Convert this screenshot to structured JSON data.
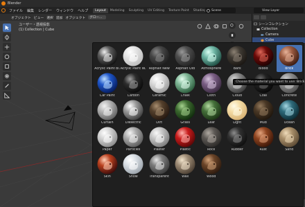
{
  "window": {
    "title": "Blender"
  },
  "menubar": {
    "menus": [
      "ファイル",
      "編集",
      "レンダー",
      "ウィンドウ",
      "ヘルプ"
    ],
    "workspaces": [
      "Layout",
      "Modeling",
      "Sculpting",
      "UV Editing",
      "Texture Paint",
      "Shading",
      "Ani"
    ],
    "active_workspace": "Layout",
    "scene_label": "Scene",
    "view_layer_label": "View Layer"
  },
  "viewport": {
    "header_items": [
      "オブジェクト",
      "ビュー",
      "選択",
      "追加",
      "オブジェクト"
    ],
    "orientation": "グロー...",
    "info_line1": "ユーザー・透視投影",
    "info_line2": "(1) Collection | Cube"
  },
  "outliner": {
    "rows": [
      {
        "label": "シーンコレクション",
        "icon": "scene-collection-icon"
      },
      {
        "label": "Collection",
        "icon": "collection-icon"
      },
      {
        "label": "Camera",
        "icon": "camera-icon"
      },
      {
        "label": "Cube",
        "icon": "cube-icon"
      }
    ]
  },
  "materials": [
    {
      "name": "Acrylic Paint Bl...",
      "base": "#101010",
      "mid": "#5a5a5a",
      "hi": "#f0f0f0"
    },
    {
      "name": "Acrylic Paint W...",
      "base": "#bdbdbd",
      "mid": "#e4e4e4",
      "hi": "#ffffff"
    },
    {
      "name": "Asphalt New",
      "base": "#1c1c1c",
      "mid": "#444444",
      "hi": "#8a8a8a"
    },
    {
      "name": "Asphalt Old",
      "base": "#262626",
      "mid": "#4d4d4d",
      "hi": "#9a9a9a"
    },
    {
      "name": "Atmosphere",
      "base": "#1e4d42",
      "mid": "#6db4a3",
      "hi": "#d9fff3"
    },
    {
      "name": "Bark",
      "base": "#1a1612",
      "mid": "#3f3a33",
      "hi": "#8d8274"
    },
    {
      "name": "Blood",
      "base": "#1c0202",
      "mid": "#6b0a08",
      "hi": "#e06a5a"
    },
    {
      "name": "Brick",
      "base": "#3a1a10",
      "mid": "#9a5a40",
      "hi": "#e8b49a"
    },
    {
      "name": "Car Paint",
      "base": "#041a5a",
      "mid": "#1f56c8",
      "hi": "#bfe0ff"
    },
    {
      "name": "Carbon",
      "base": "#0a0a0a",
      "mid": "#2c2c2c",
      "hi": "#a0a0a0"
    },
    {
      "name": "Ceramic",
      "base": "#9a9a9a",
      "mid": "#d8d8d8",
      "hi": "#ffffff"
    },
    {
      "name": "Chalk",
      "base": "#2a5a3a",
      "mid": "#7fb696",
      "hi": "#e6fff0"
    },
    {
      "name": "Cloth",
      "base": "#3a2a40",
      "mid": "#7a5e84",
      "hi": "#d5c3dc"
    },
    {
      "name": "Cloud",
      "base": "#3a3a3a",
      "mid": "#8a8a8a",
      "hi": "#d8d8d8"
    },
    {
      "name": "Coal",
      "base": "#080808",
      "mid": "#222222",
      "hi": "#707070"
    },
    {
      "name": "Concrete",
      "base": "#505050",
      "mid": "#8c8c8c",
      "hi": "#d2d2d2"
    },
    {
      "name": "Curtain",
      "base": "#606060",
      "mid": "#b4b4b4",
      "hi": "#f2f2f2"
    },
    {
      "name": "Dielectric",
      "base": "#3c3c3c",
      "mid": "#9c9c9c",
      "hi": "#ffffff"
    },
    {
      "name": "Dirt",
      "base": "#24170f",
      "mid": "#54402c",
      "hi": "#a88e70"
    },
    {
      "name": "Grass",
      "base": "#0f2a0c",
      "mid": "#3d6a30",
      "hi": "#a5d28e"
    },
    {
      "name": "Leaf",
      "base": "#1a3214",
      "mid": "#45703a",
      "hi": "#b5dca2"
    },
    {
      "name": "Light",
      "base": "#d6b072",
      "mid": "#f4dca6",
      "hi": "#fffbe8"
    },
    {
      "name": "Mud",
      "base": "#1e150c",
      "mid": "#4a3826",
      "hi": "#947a5c"
    },
    {
      "name": "Ocean",
      "base": "#0c2a32",
      "mid": "#2e6a7a",
      "hi": "#a6d8e4"
    },
    {
      "name": "Paper",
      "base": "#8a8a8a",
      "mid": "#d2d2d2",
      "hi": "#ffffff"
    },
    {
      "name": "Particles",
      "base": "#5a5a5a",
      "mid": "#aaaaaa",
      "hi": "#f4f4f4"
    },
    {
      "name": "Plaster",
      "base": "#7a7a7a",
      "mid": "#c4c4c4",
      "hi": "#fafafa"
    },
    {
      "name": "Plastic",
      "base": "#5a0606",
      "mid": "#c81c1c",
      "hi": "#ffb6b0"
    },
    {
      "name": "Rock",
      "base": "#2c2a28",
      "mid": "#5c5854",
      "hi": "#b0aaa2"
    },
    {
      "name": "Rubber",
      "base": "#0e0e0e",
      "mid": "#303030",
      "hi": "#8e8e8e"
    },
    {
      "name": "Rust",
      "base": "#3a1608",
      "mid": "#8e4420",
      "hi": "#e2a27c"
    },
    {
      "name": "Sand",
      "base": "#5c4a34",
      "mid": "#a88e6a",
      "hi": "#f0dcba"
    },
    {
      "name": "Skin",
      "base": "#3a0a0a",
      "mid": "#b8401e",
      "hi": "#ffd0b8"
    },
    {
      "name": "Snow",
      "base": "#9aa2aa",
      "mid": "#d8dee4",
      "hi": "#ffffff"
    },
    {
      "name": "Transparent",
      "base": "#3a3a3a",
      "mid": "#7a7a7a",
      "hi": "#e8e8e8"
    },
    {
      "name": "Wax",
      "base": "#4a3e32",
      "mid": "#9c8a74",
      "hi": "#f2e4cc"
    },
    {
      "name": "Wood",
      "base": "#2c1a0e",
      "mid": "#6a4428",
      "hi": "#d4a47a"
    }
  ],
  "selected_material": "Brick",
  "tooltip": {
    "text": "Choose the material you want to use: Brick"
  },
  "colors": {
    "accent": "#4772b3",
    "blender_orange": "#e87d0d",
    "panel_bg": "#1f1f1f",
    "viewport_bg": "#3a3a3a"
  }
}
